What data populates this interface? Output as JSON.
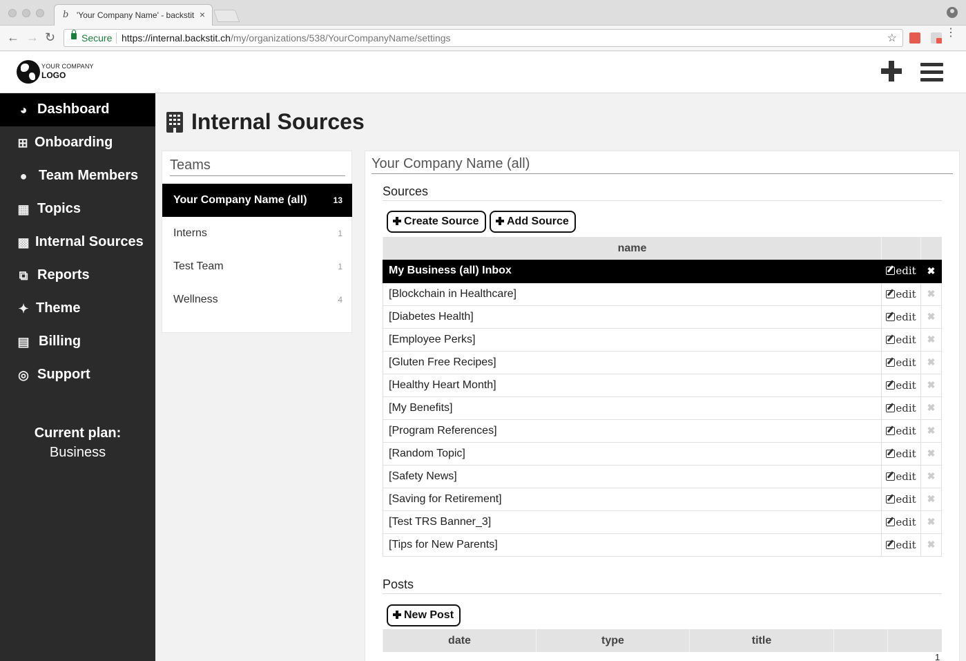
{
  "browser": {
    "tab_title": "'Your Company Name' - backstit",
    "tab_close": "×",
    "secure_label": "Secure",
    "url_host": "https://internal.backstit.ch",
    "url_path": "/my/organizations/538/YourCompanyName/settings"
  },
  "header": {
    "logo_line1": "YOUR COMPANY",
    "logo_line2": "LOGO"
  },
  "sidebar": {
    "items": [
      {
        "label": "Dashboard",
        "icon": "dashboard-icon",
        "active": true
      },
      {
        "label": "Onboarding",
        "icon": "plus-square-icon"
      },
      {
        "label": "Team Members",
        "icon": "users-icon"
      },
      {
        "label": "Topics",
        "icon": "grid-icon"
      },
      {
        "label": "Internal Sources",
        "icon": "building-icon"
      },
      {
        "label": "Reports",
        "icon": "clone-icon"
      },
      {
        "label": "Theme",
        "icon": "magic-wand-icon"
      },
      {
        "label": "Billing",
        "icon": "credit-card-icon"
      },
      {
        "label": "Support",
        "icon": "life-ring-icon"
      }
    ],
    "plan_label": "Current plan:",
    "plan_value": "Business"
  },
  "page": {
    "title": "Internal Sources"
  },
  "teams": {
    "title": "Teams",
    "rows": [
      {
        "name": "Your Company Name (all)",
        "count": "13",
        "active": true
      },
      {
        "name": "Interns",
        "count": "1"
      },
      {
        "name": "Test Team",
        "count": "1"
      },
      {
        "name": "Wellness",
        "count": "4"
      }
    ]
  },
  "main": {
    "title": "Your Company Name (all)",
    "sources_heading": "Sources",
    "create_source_label": "Create Source",
    "add_source_label": "Add Source",
    "sources_header_name": "name",
    "edit_label": "edit",
    "delete_glyph": "✖",
    "sources": [
      "My Business (all) Inbox",
      "[Blockchain in Healthcare]",
      "[Diabetes Health]",
      "[Employee Perks]",
      "[Gluten Free Recipes]",
      "[Healthy Heart Month]",
      "[My Benefits]",
      "[Program References]",
      "[Random Topic]",
      "[Safety News]",
      "[Saving for Retirement]",
      "[Test TRS Banner_3]",
      "[Tips for New Parents]"
    ],
    "posts_heading": "Posts",
    "new_post_label": "New Post",
    "posts_headers": [
      "date",
      "type",
      "title",
      "",
      ""
    ],
    "page_number": "1"
  }
}
